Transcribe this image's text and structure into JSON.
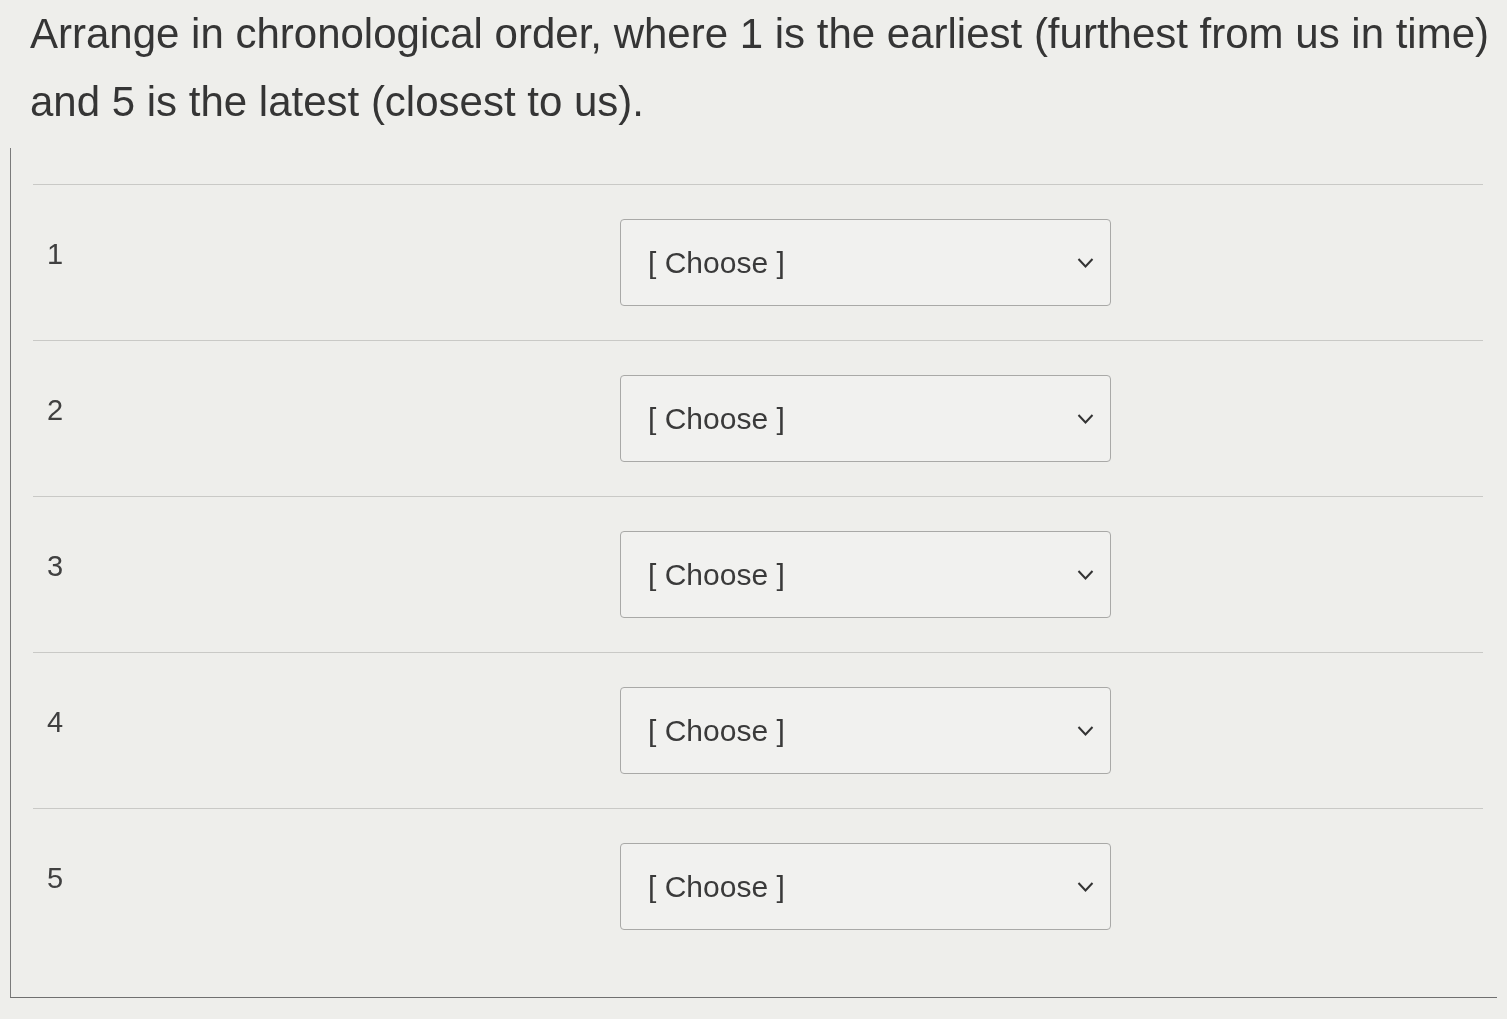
{
  "prompt": "Arrange in chronological order, where 1 is the earliest (furthest from us in time) and 5 is the latest (closest to us).",
  "rows": [
    {
      "number": "1",
      "dropdown": {
        "value": "[ Choose ]"
      }
    },
    {
      "number": "2",
      "dropdown": {
        "value": "[ Choose ]"
      }
    },
    {
      "number": "3",
      "dropdown": {
        "value": "[ Choose ]"
      }
    },
    {
      "number": "4",
      "dropdown": {
        "value": "[ Choose ]"
      }
    },
    {
      "number": "5",
      "dropdown": {
        "value": "[ Choose ]"
      }
    }
  ]
}
